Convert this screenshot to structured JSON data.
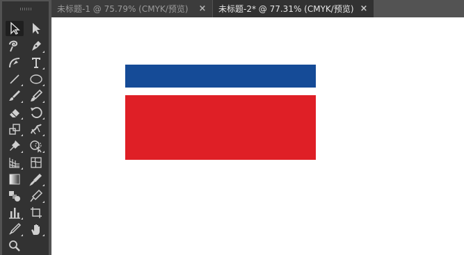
{
  "tabs": [
    {
      "label": "未标题-1 @ 75.79% (CMYK/预览)",
      "close": "×",
      "active": false
    },
    {
      "label": "未标题-2* @ 77.31% (CMYK/预览)",
      "close": "×",
      "active": true
    }
  ],
  "toolbar": {
    "tools": [
      {
        "name": "selection-tool-icon",
        "active": true
      },
      {
        "name": "direct-selection-tool-icon"
      },
      {
        "name": "magic-wand-tool-icon"
      },
      {
        "name": "pen-tool-icon"
      },
      {
        "name": "curvature-tool-icon"
      },
      {
        "name": "type-tool-icon",
        "glyph": "T"
      },
      {
        "name": "line-segment-tool-icon"
      },
      {
        "name": "ellipse-tool-icon"
      },
      {
        "name": "paintbrush-tool-icon"
      },
      {
        "name": "blob-brush-tool-icon"
      },
      {
        "name": "eraser-tool-icon"
      },
      {
        "name": "rotate-tool-icon"
      },
      {
        "name": "scale-tool-icon"
      },
      {
        "name": "puppet-warp-tool-icon"
      },
      {
        "name": "pin-tool-icon"
      },
      {
        "name": "shape-builder-tool-icon"
      },
      {
        "name": "perspective-grid-tool-icon"
      },
      {
        "name": "mesh-tool-icon"
      },
      {
        "name": "gradient-tool-icon"
      },
      {
        "name": "eyedropper-tool-icon"
      },
      {
        "name": "blend-tool-icon"
      },
      {
        "name": "symbol-sprayer-tool-icon"
      },
      {
        "name": "column-graph-tool-icon"
      },
      {
        "name": "artboard-tool-icon"
      },
      {
        "name": "slice-tool-icon"
      },
      {
        "name": "hand-tool-icon"
      },
      {
        "name": "zoom-tool-icon"
      }
    ]
  },
  "canvas": {
    "background": "#ffffff",
    "shapes": [
      {
        "name": "blue-stripe",
        "color": "#154b97"
      },
      {
        "name": "red-rectangle",
        "color": "#df1f26"
      }
    ]
  },
  "colors": {
    "ui_dark": "#323232",
    "ui_mid": "#535353",
    "icon": "#cfcfcf"
  }
}
